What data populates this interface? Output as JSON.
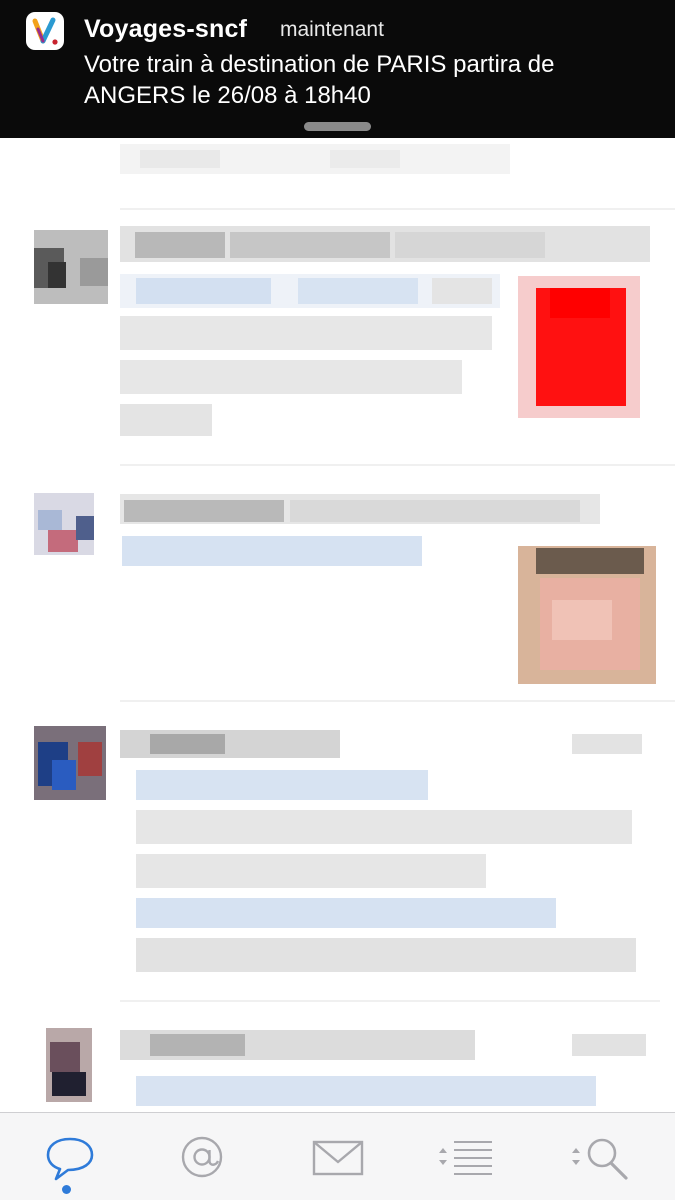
{
  "notification": {
    "app_name": "Voyages-sncf",
    "time": "maintenant",
    "message": "Votre train à destination de PARIS partira de ANGERS le 26/08 à 18h40"
  },
  "tabs": [
    {
      "name": "conversations",
      "icon": "speech-bubble-icon",
      "active": true
    },
    {
      "name": "mentions",
      "icon": "at-sign-icon",
      "active": false
    },
    {
      "name": "messages",
      "icon": "envelope-icon",
      "active": false
    },
    {
      "name": "lists",
      "icon": "list-icon",
      "active": false
    },
    {
      "name": "search",
      "icon": "magnifier-icon",
      "active": false
    }
  ],
  "colors": {
    "banner_bg": "#0a0a0a",
    "accent": "#2f7bd9",
    "tab_icon": "#a8a8ad"
  }
}
